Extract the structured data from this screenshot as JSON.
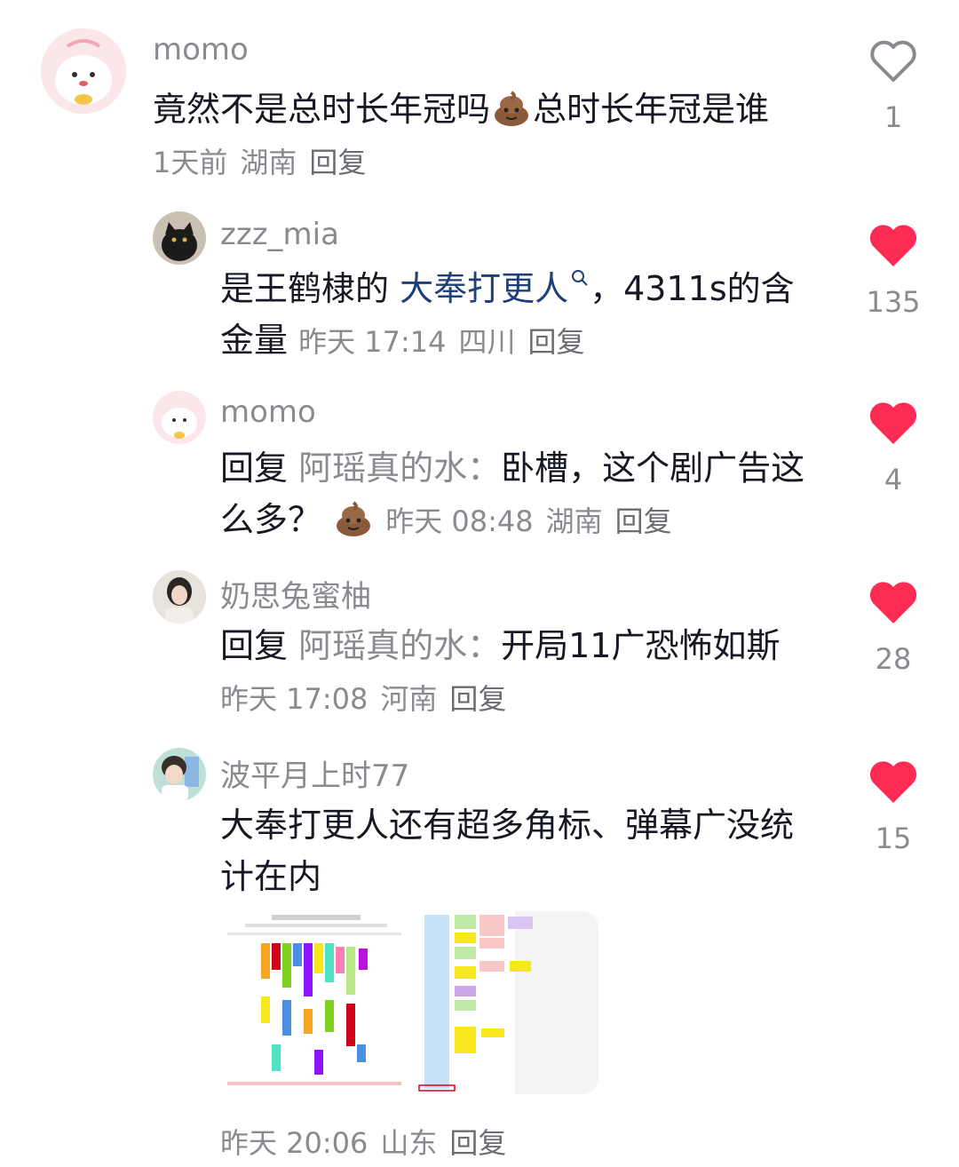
{
  "comments": [
    {
      "user": "momo",
      "text": "竟然不是总时长年冠吗",
      "text_after_emoji": "总时长年冠是谁",
      "time": "1天前",
      "location": "湖南",
      "reply_label": "回复",
      "like_count": "1",
      "liked": false
    },
    {
      "user": "zzz_mia",
      "text_before_link": "是王鹤棣的",
      "link_text": "大奉打更人",
      "text_after_link": "，4311s的含金量",
      "time": "昨天 17:14",
      "location": "四川",
      "reply_label": "回复",
      "like_count": "135",
      "liked": true
    },
    {
      "user": "momo",
      "reply_prefix": "回复",
      "reply_target": "阿瑶真的水：",
      "text": "卧槽，这个剧广告这么多？",
      "time": "昨天 08:48",
      "location": "湖南",
      "reply_label": "回复",
      "like_count": "4",
      "liked": true
    },
    {
      "user": "奶思兔蜜柚",
      "reply_prefix": "回复",
      "reply_target": "阿瑶真的水：",
      "text": "开局11广恐怖如斯",
      "time": "昨天 17:08",
      "location": "河南",
      "reply_label": "回复",
      "like_count": "28",
      "liked": true
    },
    {
      "user": "波平月上时77",
      "text": "大奉打更人还有超多角标、弹幕广没统计在内",
      "time": "昨天 20:06",
      "location": "山东",
      "reply_label": "回复",
      "like_count": "15",
      "liked": true
    }
  ],
  "colors": {
    "like_red": "#fe2c55",
    "gray_text": "#8a8b91",
    "body_text": "#161823",
    "link_blue": "#1f3f78"
  }
}
